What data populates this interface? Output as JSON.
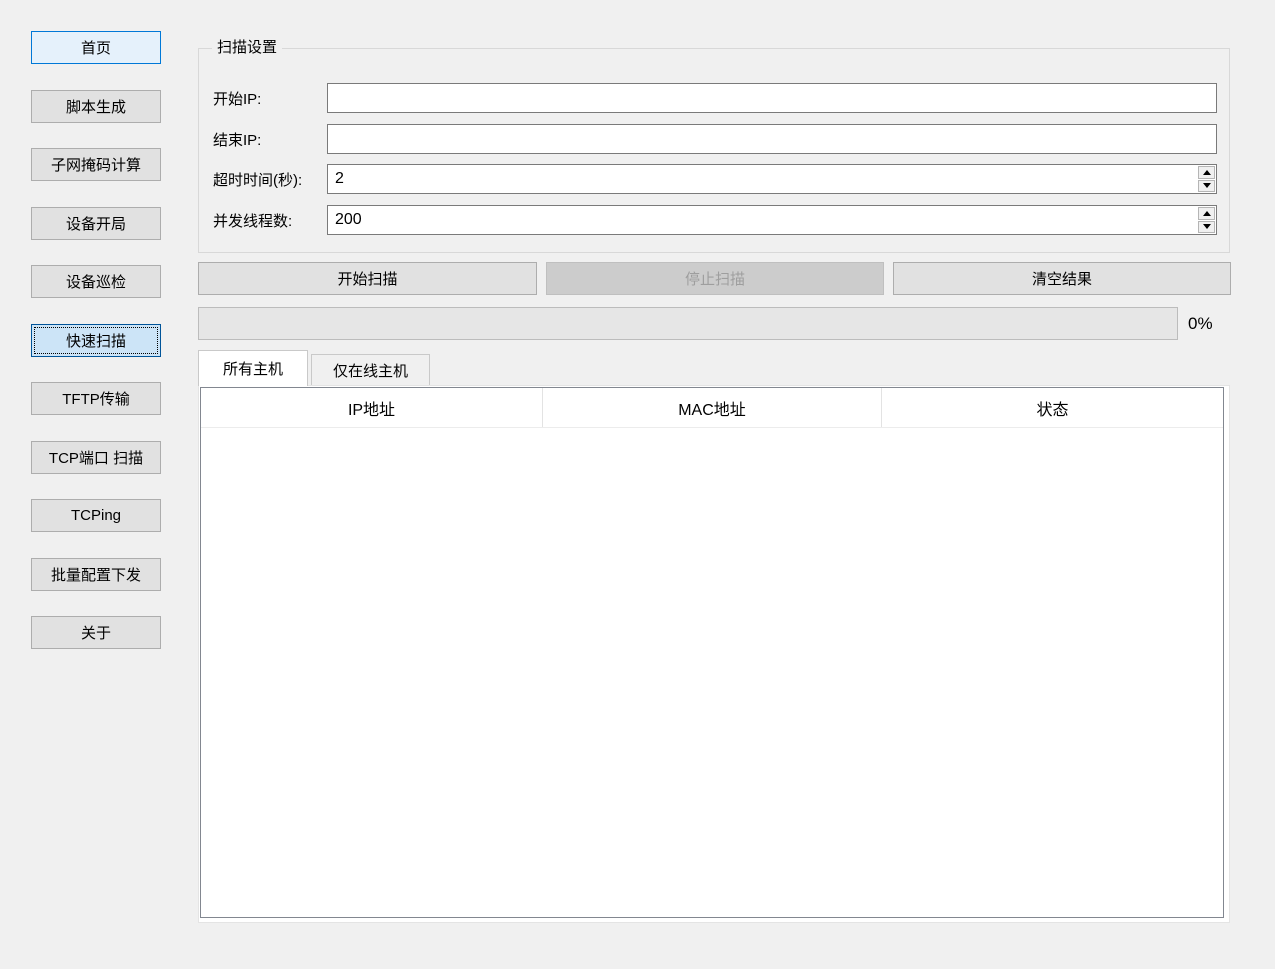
{
  "sidebar": {
    "items": [
      {
        "label": "首页"
      },
      {
        "label": "脚本生成"
      },
      {
        "label": "子网掩码计算"
      },
      {
        "label": "设备开局"
      },
      {
        "label": "设备巡检"
      },
      {
        "label": "快速扫描"
      },
      {
        "label": "TFTP传输"
      },
      {
        "label": "TCP端口 扫描"
      },
      {
        "label": "TCPing"
      },
      {
        "label": "批量配置下发"
      },
      {
        "label": "关于"
      }
    ]
  },
  "scan_settings": {
    "title": "扫描设置",
    "start_ip": {
      "label": "开始IP:",
      "value": ""
    },
    "end_ip": {
      "label": "结束IP:",
      "value": ""
    },
    "timeout": {
      "label": "超时时间(秒):",
      "value": "2"
    },
    "threads": {
      "label": "并发线程数:",
      "value": "200"
    }
  },
  "actions": {
    "start": "开始扫描",
    "stop": "停止扫描",
    "clear": "清空结果"
  },
  "progress": {
    "percent": 0,
    "label": "0%"
  },
  "tabs": {
    "all_hosts": "所有主机",
    "online_hosts": "仅在线主机"
  },
  "hosts_table": {
    "columns": [
      "IP地址",
      "MAC地址",
      "状态"
    ],
    "rows": []
  },
  "colors": {
    "window_background": "#f0f0f0",
    "button_background": "#e1e1e1",
    "button_border": "#adadad",
    "button_hover_background": "#e5f1fb",
    "button_hover_border": "#0078d7",
    "button_focus_background": "#cce4f7",
    "button_focus_border": "#005499",
    "disabled_button_background": "#cccccc",
    "disabled_button_text": "#9e9e9e",
    "input_border": "#7a7a7a",
    "table_frame": "#828790"
  }
}
